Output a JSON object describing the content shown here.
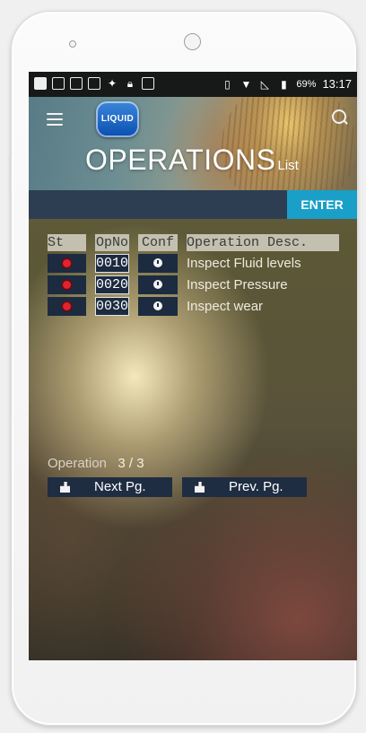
{
  "status_bar": {
    "battery_percent": "69%",
    "clock": "13:17",
    "left_icons": [
      "message-icon",
      "image-icon",
      "app-icon",
      "photo-icon",
      "android-icon",
      "lock-icon",
      "app-icon"
    ],
    "right_icons": [
      "vibrate-icon",
      "wifi-icon",
      "no-signal-icon",
      "battery-icon"
    ]
  },
  "header": {
    "logo_text": "LIQUID",
    "title": "OPERATIONS",
    "subtitle": "List"
  },
  "action_bar": {
    "enter_label": "ENTER"
  },
  "table": {
    "headers": {
      "st": "St",
      "opno": "OpNo",
      "conf": "Conf",
      "desc": "Operation Desc."
    },
    "rows": [
      {
        "opno": "0010",
        "desc": "Inspect Fluid levels"
      },
      {
        "opno": "0020",
        "desc": "Inspect Pressure"
      },
      {
        "opno": "0030",
        "desc": "Inspect wear"
      }
    ]
  },
  "pager": {
    "label": "Operation",
    "count": "3 / 3",
    "next_label": "Next Pg.",
    "prev_label": "Prev. Pg."
  },
  "colors": {
    "accent": "#1a9fc8",
    "bar": "#2d3e52",
    "cell": "#1c2b40",
    "status_dot": "#e12430"
  }
}
